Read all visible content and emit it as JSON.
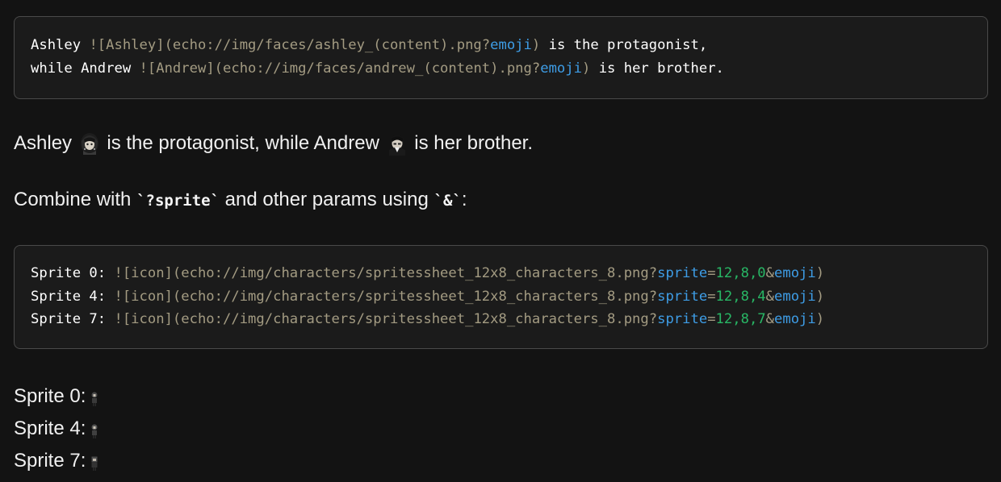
{
  "code1": {
    "line1": {
      "lead": "Ashley ",
      "open": "![Ashley](echo://img/faces/ashley_(content).png?",
      "param": "emoji",
      "close": ")",
      "tail": " is the protagonist,"
    },
    "line2": {
      "lead": "while Andrew ",
      "open": "![Andrew](echo://img/faces/andrew_(content).png?",
      "param": "emoji",
      "close": ")",
      "tail": " is her brother."
    }
  },
  "rendered": {
    "name1": "Ashley",
    "mid": "is the protagonist, while Andrew",
    "end": "is her brother."
  },
  "combine": {
    "before": "Combine with ",
    "code1": "`?sprite`",
    "middle": " and other params using ",
    "code2": "`&`",
    "after": ":"
  },
  "code2": {
    "lines": [
      {
        "label": "Sprite 0: ",
        "open": "![icon](echo://img/characters/spritessheet_12x8_characters_8.png?",
        "param": "sprite",
        "eq": "=",
        "val": "12,8,0",
        "amp": "&",
        "param2": "emoji",
        "close": ")"
      },
      {
        "label": "Sprite 4: ",
        "open": "![icon](echo://img/characters/spritessheet_12x8_characters_8.png?",
        "param": "sprite",
        "eq": "=",
        "val": "12,8,4",
        "amp": "&",
        "param2": "emoji",
        "close": ")"
      },
      {
        "label": "Sprite 7: ",
        "open": "![icon](echo://img/characters/spritessheet_12x8_characters_8.png?",
        "param": "sprite",
        "eq": "=",
        "val": "12,8,7",
        "amp": "&",
        "param2": "emoji",
        "close": ")"
      }
    ]
  },
  "sprites": [
    {
      "label": "Sprite 0:"
    },
    {
      "label": "Sprite 4:"
    },
    {
      "label": "Sprite 7:"
    }
  ],
  "icons": {
    "ashley_face": "ashley-face-icon",
    "andrew_face": "andrew-face-icon",
    "sprite": "character-sprite-icon"
  }
}
